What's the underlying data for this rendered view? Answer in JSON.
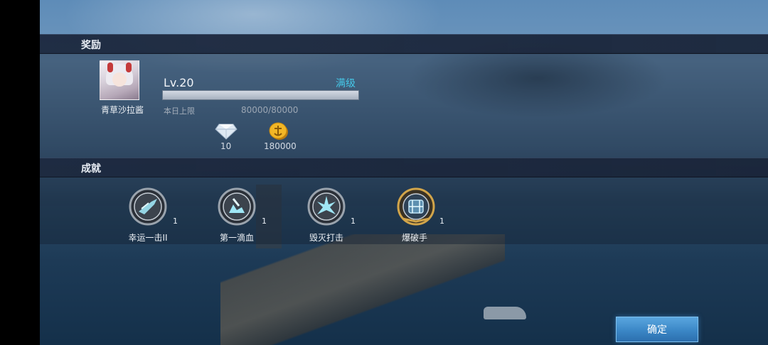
{
  "sections": {
    "rewards_title": "奖励",
    "achievements_title": "成就"
  },
  "player": {
    "name": "青草沙拉酱",
    "level": "Lv.20",
    "status": "满级",
    "xp_progress": 1.0,
    "daily_limit_label": "本日上限",
    "daily_limit_value": "80000/80000"
  },
  "resources": [
    {
      "icon": "diamond-icon",
      "value": "10"
    },
    {
      "icon": "gold-coin-icon",
      "value": "180000"
    }
  ],
  "achievements": [
    {
      "icon": "lucky-shot-medal-icon",
      "label": "幸运一击II",
      "count": "1"
    },
    {
      "icon": "first-blood-medal-icon",
      "label": "第一滴血",
      "count": "1"
    },
    {
      "icon": "destruction-strike-medal-icon",
      "label": "毁灭打击",
      "count": "1"
    },
    {
      "icon": "demolition-medal-icon",
      "label": "爆破手",
      "count": "1"
    }
  ],
  "buttons": {
    "confirm": "确定"
  },
  "colors": {
    "accent_cyan": "#45c8e8",
    "button_blue": "#3b87c6",
    "header_bg": "#1c283e"
  }
}
